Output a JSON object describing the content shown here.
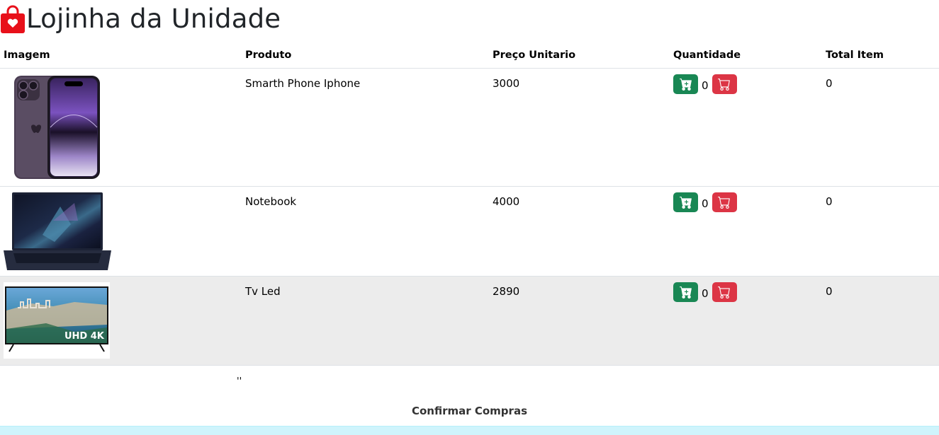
{
  "page": {
    "title": "Lojinha da Unidade",
    "accent": "#e8101a"
  },
  "table": {
    "headers": [
      "Imagem",
      "Produto",
      "Preço Unitario",
      "Quantidade",
      "Total Item"
    ],
    "rows": [
      {
        "image": "iphone-image",
        "produto": "Smarth Phone Iphone",
        "preco": "3000",
        "quantidade": "0",
        "total": "0"
      },
      {
        "image": "notebook-image",
        "produto": "Notebook",
        "preco": "4000",
        "quantidade": "0",
        "total": "0"
      },
      {
        "image": "tv-image",
        "produto": "Tv Led",
        "preco": "2890",
        "quantidade": "0",
        "total": "0"
      }
    ]
  },
  "tv_badge": "UHD 4K",
  "stray_text": "''",
  "confirm_label": "Confirmar Compras",
  "colors": {
    "add_button": "#198754",
    "remove_button": "#dc3545",
    "footer": "#cff4fc"
  }
}
